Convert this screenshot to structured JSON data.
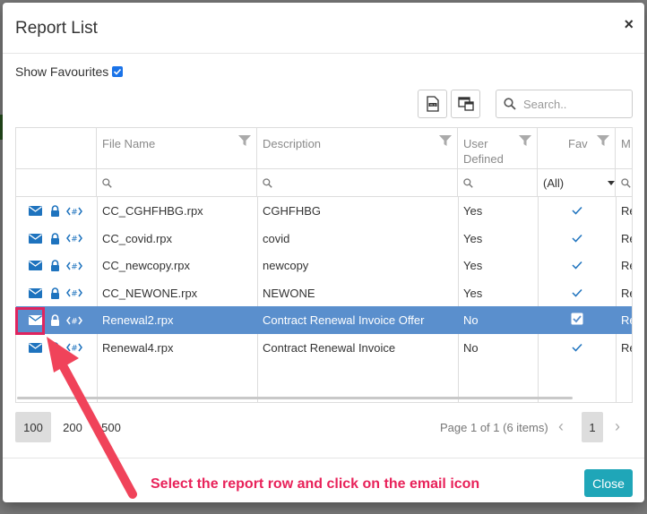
{
  "modal": {
    "title": "Report List",
    "close_symbol": "×",
    "show_favourites_label": "Show Favourites",
    "search_placeholder": "Search..",
    "close_button": "Close"
  },
  "columns": {
    "file_name": "File Name",
    "description": "Description",
    "user_defined_1": "User",
    "user_defined_2": "Defined",
    "fav": "Fav",
    "more": "M"
  },
  "filter": {
    "fav_select": "(All)"
  },
  "rows": [
    {
      "file": "CC_CGHFHBG.rpx",
      "desc": "CGHFHBG",
      "user": "Yes",
      "more": "Re"
    },
    {
      "file": "CC_covid.rpx",
      "desc": "covid",
      "user": "Yes",
      "more": "Re"
    },
    {
      "file": "CC_newcopy.rpx",
      "desc": "newcopy",
      "user": "Yes",
      "more": "Re"
    },
    {
      "file": "CC_NEWONE.rpx",
      "desc": "NEWONE",
      "user": "Yes",
      "more": "Re"
    },
    {
      "file": "Renewal2.rpx",
      "desc": "Contract Renewal Invoice Offer",
      "user": "No",
      "more": "Re"
    },
    {
      "file": "Renewal4.rpx",
      "desc": "Contract Renewal Invoice",
      "user": "No",
      "more": "Re"
    }
  ],
  "selected_row_index": 4,
  "pager": {
    "sizes": [
      "100",
      "200",
      "500"
    ],
    "info": "Page 1 of 1 (6 items)",
    "current_page": "1"
  },
  "annotation": {
    "text": "Select the report row and click on the email icon"
  },
  "colors": {
    "selected_row": "#5a8fcd",
    "close_button": "#1fa6b8",
    "annotation": "#e8225a",
    "icon_blue": "#1e73be"
  }
}
